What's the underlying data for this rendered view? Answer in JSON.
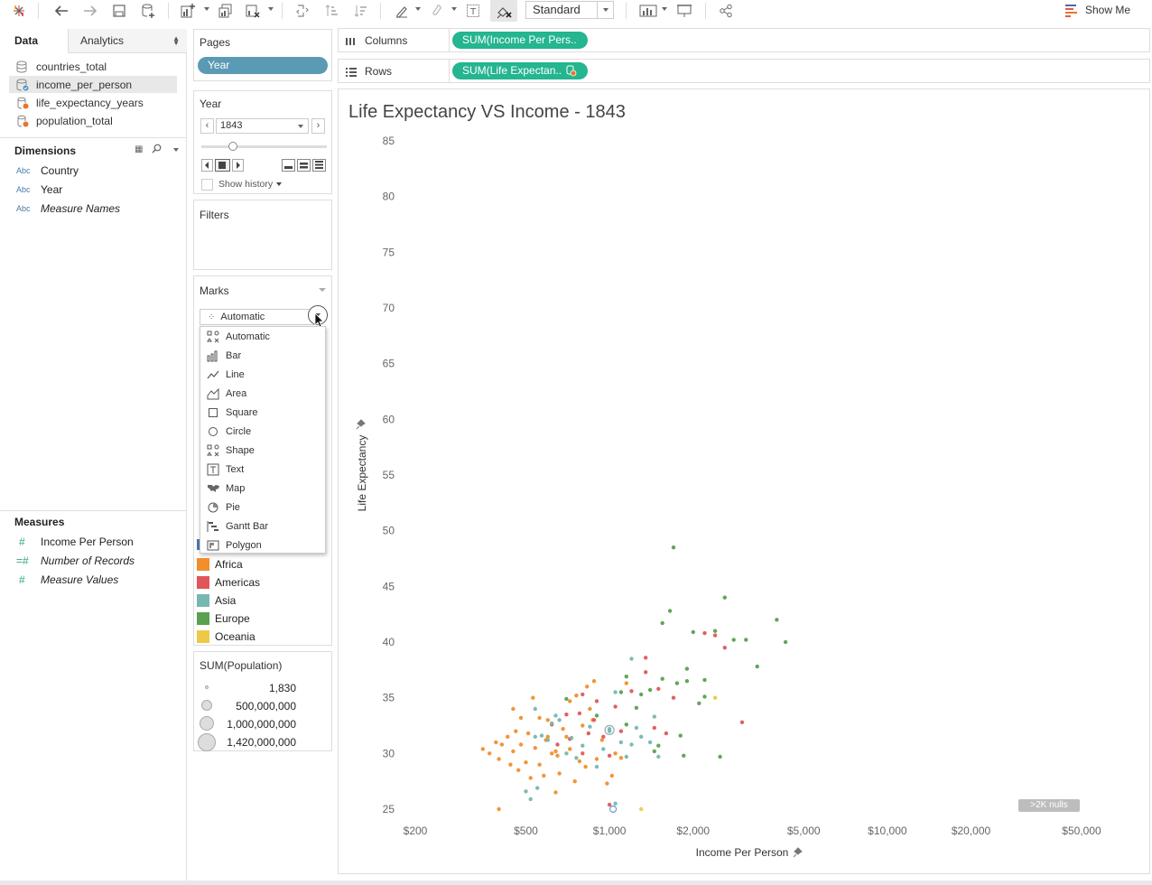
{
  "toolbar": {
    "mark_type_preset": "Standard",
    "show_me_label": "Show Me"
  },
  "data_pane": {
    "tabs": [
      {
        "label": "Data"
      },
      {
        "label": "Analytics"
      }
    ],
    "datasources": [
      {
        "label": "countries_total"
      },
      {
        "label": "income_per_person"
      },
      {
        "label": "life_expectancy_years"
      },
      {
        "label": "population_total"
      }
    ],
    "dimensions_title": "Dimensions",
    "dimensions": [
      {
        "type": "Abc",
        "label": "Country"
      },
      {
        "type": "Abc",
        "label": "Year"
      },
      {
        "type": "Abc",
        "label": "Measure Names"
      }
    ],
    "measures_title": "Measures",
    "measures": [
      {
        "type": "#",
        "label": "Income Per Person"
      },
      {
        "type": "=#",
        "label": "Number of Records"
      },
      {
        "type": "#",
        "label": "Measure Values"
      }
    ]
  },
  "pages": {
    "title": "Pages",
    "pill": "Year"
  },
  "year_control": {
    "title": "Year",
    "value": "1843",
    "show_history": "Show history",
    "slider_position": 0.2
  },
  "filters": {
    "title": "Filters"
  },
  "marks": {
    "title": "Marks",
    "selected": "Automatic",
    "menu": [
      {
        "label": "Automatic",
        "icon": "automatic-icon"
      },
      {
        "label": "Bar",
        "icon": "bar-icon"
      },
      {
        "label": "Line",
        "icon": "line-icon"
      },
      {
        "label": "Area",
        "icon": "area-icon"
      },
      {
        "label": "Square",
        "icon": "square-icon"
      },
      {
        "label": "Circle",
        "icon": "circle-icon"
      },
      {
        "label": "Shape",
        "icon": "shape-icon"
      },
      {
        "label": "Text",
        "icon": "text-icon"
      },
      {
        "label": "Map",
        "icon": "map-icon"
      },
      {
        "label": "Pie",
        "icon": "pie-icon"
      },
      {
        "label": "Gantt Bar",
        "icon": "gantt-icon"
      },
      {
        "label": "Polygon",
        "icon": "polygon-icon"
      }
    ]
  },
  "color_legend": [
    {
      "label": "Africa",
      "color": "#f28e2b"
    },
    {
      "label": "Americas",
      "color": "#e15759"
    },
    {
      "label": "Asia",
      "color": "#76b7b2"
    },
    {
      "label": "Europe",
      "color": "#59a14f"
    },
    {
      "label": "Oceania",
      "color": "#edc948"
    }
  ],
  "size_legend": {
    "title": "SUM(Population)",
    "items": [
      {
        "label": "1,830"
      },
      {
        "label": "500,000,000"
      },
      {
        "label": "1,000,000,000"
      },
      {
        "label": "1,420,000,000"
      }
    ]
  },
  "shelves": {
    "columns_label": "Columns",
    "columns_pill": "SUM(Income Per Pers..",
    "rows_label": "Rows",
    "rows_pill": "SUM(Life Expectan.."
  },
  "viz": {
    "title": "Life Expectancy VS Income - 1843",
    "nulls_badge": ">2K nulls"
  },
  "chart_data": {
    "type": "scatter",
    "title": "Life Expectancy VS Income - 1843",
    "xlabel": "Income Per Person",
    "ylabel": "Life Expectancy",
    "x_scale": "log",
    "x_ticks": [
      {
        "v": 200,
        "label": "$200"
      },
      {
        "v": 500,
        "label": "$500"
      },
      {
        "v": 1000,
        "label": "$1,000"
      },
      {
        "v": 2000,
        "label": "$2,000"
      },
      {
        "v": 5000,
        "label": "$5,000"
      },
      {
        "v": 10000,
        "label": "$10,000"
      },
      {
        "v": 20000,
        "label": "$20,000"
      },
      {
        "v": 50000,
        "label": "$50,000"
      }
    ],
    "y_ticks": [
      25,
      30,
      35,
      40,
      45,
      50,
      55,
      60,
      65,
      70,
      75,
      80,
      85
    ],
    "xlim": [
      180,
      60000
    ],
    "ylim": [
      24.5,
      85.5
    ],
    "grid": false,
    "series": [
      {
        "name": "Africa",
        "points": [
          [
            350,
            30.4
          ],
          [
            370,
            30.0
          ],
          [
            390,
            31.0
          ],
          [
            400,
            29.5
          ],
          [
            410,
            30.8
          ],
          [
            430,
            31.5
          ],
          [
            440,
            29.0
          ],
          [
            450,
            30.2
          ],
          [
            460,
            32.0
          ],
          [
            470,
            28.5
          ],
          [
            480,
            30.8
          ],
          [
            500,
            29.2
          ],
          [
            510,
            31.8
          ],
          [
            520,
            27.8
          ],
          [
            540,
            30.5
          ],
          [
            560,
            29.0
          ],
          [
            580,
            28.0
          ],
          [
            590,
            31.2
          ],
          [
            600,
            33.0
          ],
          [
            620,
            30.0
          ],
          [
            640,
            26.5
          ],
          [
            650,
            29.8
          ],
          [
            660,
            28.2
          ],
          [
            700,
            31.5
          ],
          [
            720,
            30.4
          ],
          [
            750,
            27.5
          ],
          [
            780,
            29.3
          ],
          [
            800,
            32.5
          ],
          [
            820,
            28.8
          ],
          [
            850,
            34.0
          ],
          [
            870,
            33.0
          ],
          [
            900,
            29.5
          ],
          [
            940,
            31.2
          ],
          [
            980,
            27.3
          ],
          [
            1020,
            28.0
          ],
          [
            1050,
            30.0
          ],
          [
            1100,
            29.6
          ],
          [
            560,
            33.2
          ],
          [
            530,
            35.0
          ],
          [
            450,
            34.0
          ],
          [
            480,
            33.2
          ],
          [
            680,
            32.2
          ],
          [
            720,
            34.7
          ],
          [
            760,
            35.2
          ],
          [
            830,
            36.0
          ],
          [
            880,
            36.5
          ],
          [
            400,
            25.0
          ],
          [
            1150,
            36.3
          ],
          [
            640,
            30.2
          ],
          [
            600,
            31.5
          ]
        ]
      },
      {
        "name": "Americas",
        "points": [
          [
            620,
            32.6
          ],
          [
            650,
            30.8
          ],
          [
            700,
            33.5
          ],
          [
            720,
            31.3
          ],
          [
            780,
            33.6
          ],
          [
            800,
            30.0
          ],
          [
            840,
            31.8
          ],
          [
            880,
            33.0
          ],
          [
            900,
            34.7
          ],
          [
            950,
            31.5
          ],
          [
            1000,
            29.8
          ],
          [
            1050,
            34.2
          ],
          [
            1100,
            32.0
          ],
          [
            1200,
            35.6
          ],
          [
            1350,
            38.6
          ],
          [
            1450,
            32.3
          ],
          [
            1500,
            35.8
          ],
          [
            1700,
            35.0
          ],
          [
            2200,
            40.8
          ],
          [
            2400,
            40.6
          ],
          [
            2600,
            39.5
          ],
          [
            3000,
            32.8
          ],
          [
            1600,
            31.8
          ],
          [
            1000,
            25.4
          ],
          [
            1350,
            37.3
          ],
          [
            800,
            35.3
          ]
        ]
      },
      {
        "name": "Asia",
        "points": [
          [
            500,
            26.6
          ],
          [
            520,
            25.9
          ],
          [
            540,
            34.0
          ],
          [
            570,
            31.6
          ],
          [
            600,
            31.2
          ],
          [
            620,
            32.7
          ],
          [
            640,
            33.4
          ],
          [
            660,
            33.0
          ],
          [
            700,
            30.0
          ],
          [
            730,
            31.4
          ],
          [
            760,
            29.6
          ],
          [
            800,
            30.7
          ],
          [
            850,
            32.4
          ],
          [
            900,
            28.8
          ],
          [
            950,
            30.4
          ],
          [
            1000,
            32.2
          ],
          [
            1050,
            35.5
          ],
          [
            1100,
            31.0
          ],
          [
            1150,
            29.7
          ],
          [
            1200,
            30.8
          ],
          [
            1250,
            32.3
          ],
          [
            1300,
            31.5
          ],
          [
            1400,
            31.0
          ],
          [
            1450,
            33.3
          ],
          [
            1500,
            29.7
          ],
          [
            1000,
            32.0
          ],
          [
            550,
            26.9
          ],
          [
            1200,
            38.5
          ],
          [
            1050,
            25.5
          ],
          [
            540,
            31.5
          ]
        ]
      },
      {
        "name": "Europe",
        "points": [
          [
            700,
            34.9
          ],
          [
            900,
            33.4
          ],
          [
            1100,
            35.5
          ],
          [
            1150,
            36.9
          ],
          [
            1250,
            34.1
          ],
          [
            1400,
            35.7
          ],
          [
            1450,
            30.2
          ],
          [
            1500,
            30.7
          ],
          [
            1550,
            41.7
          ],
          [
            1650,
            42.8
          ],
          [
            1700,
            48.5
          ],
          [
            1750,
            36.3
          ],
          [
            1800,
            31.6
          ],
          [
            1850,
            29.8
          ],
          [
            1900,
            37.6
          ],
          [
            2000,
            40.9
          ],
          [
            2200,
            35.1
          ],
          [
            2400,
            41.0
          ],
          [
            2500,
            29.7
          ],
          [
            2600,
            44.0
          ],
          [
            2800,
            40.2
          ],
          [
            3100,
            40.2
          ],
          [
            3400,
            37.8
          ],
          [
            4000,
            42.0
          ],
          [
            4300,
            40.0
          ],
          [
            1550,
            36.7
          ],
          [
            1900,
            36.5
          ],
          [
            2100,
            34.5
          ],
          [
            1300,
            35.3
          ],
          [
            1150,
            32.6
          ],
          [
            2200,
            36.6
          ]
        ]
      },
      {
        "name": "Oceania",
        "points": [
          [
            2400,
            35.0
          ],
          [
            1300,
            25.0
          ]
        ]
      }
    ]
  }
}
